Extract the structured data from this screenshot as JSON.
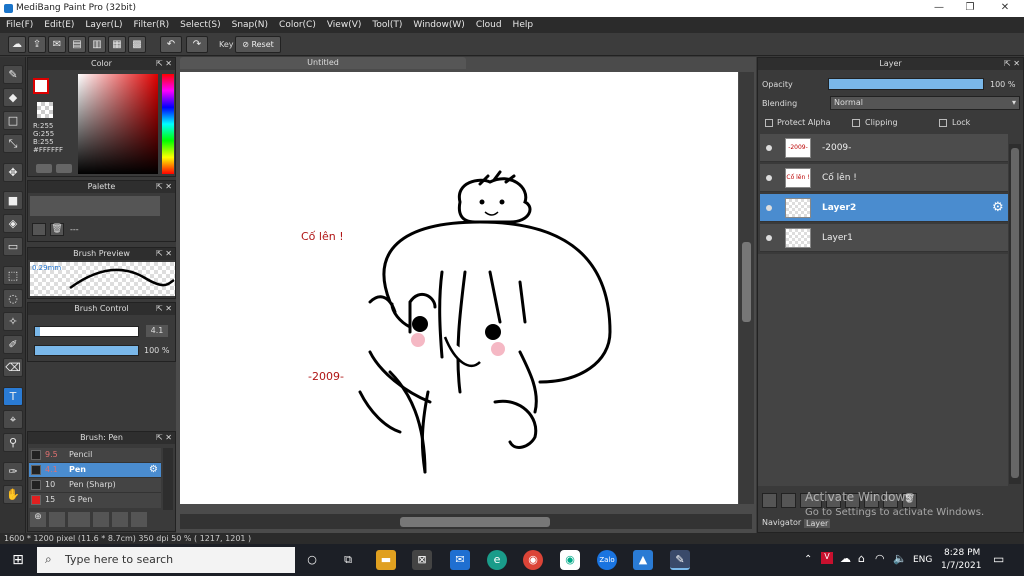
{
  "app": {
    "title": "MediBang Paint Pro (32bit)"
  },
  "window_controls": {
    "minimize": "—",
    "maximize": "❐",
    "close": "✕"
  },
  "menu": [
    "File(F)",
    "Edit(E)",
    "Layer(L)",
    "Filter(R)",
    "Select(S)",
    "Snap(N)",
    "Color(C)",
    "View(V)",
    "Tool(T)",
    "Window(W)",
    "Cloud",
    "Help"
  ],
  "toolbar": {
    "key_label": "Key",
    "reset_label": "Reset"
  },
  "color_panel": {
    "title": "Color",
    "r": "R:255",
    "g": "G:255",
    "b": "B:255",
    "hex": "#FFFFFF",
    "accent": "#cc0000"
  },
  "palette_panel": {
    "title": "Palette",
    "placeholder": "---"
  },
  "brush_preview": {
    "title": "Brush Preview",
    "size": "0.29mm"
  },
  "brush_control": {
    "title": "Brush Control",
    "size_value": "4.1",
    "opacity_value": "100 %",
    "size_fraction": 0.95,
    "opacity_fraction": 1.0
  },
  "brush_panel": {
    "title": "Brush: Pen",
    "items": [
      {
        "size": "9.5",
        "name": "Pencil",
        "color": "#222222"
      },
      {
        "size": "4.1",
        "name": "Pen",
        "color": "#222222",
        "selected": true
      },
      {
        "size": "10",
        "name": "Pen (Sharp)",
        "color": "#222222"
      },
      {
        "size": "15",
        "name": "G Pen",
        "color": "#e02020"
      }
    ]
  },
  "document": {
    "tab": "Untitled",
    "text1": "Cố lên !",
    "text2": "-2009-"
  },
  "layer_panel": {
    "title": "Layer",
    "opacity_label": "Opacity",
    "opacity_value": "100 %",
    "opacity_fraction": 1.0,
    "blending_label": "Blending",
    "blending_value": "Normal",
    "protect_alpha": "Protect Alpha",
    "clipping": "Clipping",
    "lock": "Lock",
    "layers": [
      {
        "name": "-2009-",
        "thumb": "-2009-",
        "selected": false
      },
      {
        "name": "Cố lên !",
        "thumb": "Cố lên !",
        "selected": false
      },
      {
        "name": "Layer2",
        "thumb": "",
        "selected": true
      },
      {
        "name": "Layer1",
        "thumb": "",
        "selected": false
      }
    ],
    "bottom_tabs": [
      "Navigator",
      "Layer"
    ]
  },
  "watermark": {
    "line1": "Activate Windows",
    "line2": "Go to Settings to activate Windows."
  },
  "status": {
    "text": "1600 * 1200 pixel  (11.6 * 8.7cm)  350 dpi  50 %  ( 1217, 1201 )"
  },
  "taskbar": {
    "search_placeholder": "Type here to search",
    "lang": "ENG",
    "time": "8:28 PM",
    "date": "1/7/2021"
  }
}
